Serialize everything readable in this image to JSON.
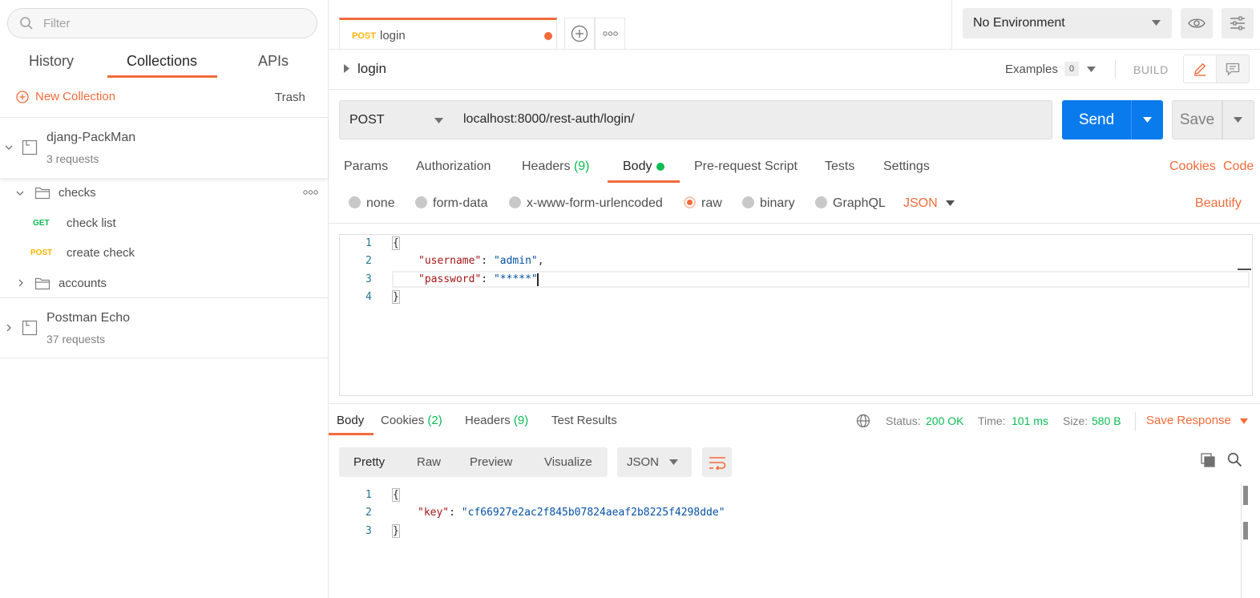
{
  "sidebar": {
    "filter_placeholder": "Filter",
    "tabs": [
      "History",
      "Collections",
      "APIs"
    ],
    "new_collection": "New Collection",
    "trash": "Trash",
    "collections": [
      {
        "name": "djang-PackMan",
        "count": "3 requests",
        "folders": [
          {
            "name": "checks",
            "requests": [
              {
                "method": "GET",
                "name": "check list"
              },
              {
                "method": "POST",
                "name": "create check"
              }
            ]
          },
          {
            "name": "accounts"
          }
        ]
      },
      {
        "name": "Postman Echo",
        "count": "37 requests"
      }
    ]
  },
  "tabbar": {
    "tab_method": "POST",
    "tab_name": "login",
    "environment": "No Environment"
  },
  "request": {
    "name": "login",
    "examples_label": "Examples",
    "examples_count": "0",
    "build_label": "BUILD",
    "method": "POST",
    "url": "localhost:8000/rest-auth/login/",
    "send": "Send",
    "save": "Save",
    "tabs": {
      "params": "Params",
      "authorization": "Authorization",
      "headers": "Headers",
      "headers_count": "(9)",
      "body": "Body",
      "prerequest": "Pre-request Script",
      "tests": "Tests",
      "settings": "Settings"
    },
    "cookies": "Cookies",
    "code": "Code",
    "body_types": [
      "none",
      "form-data",
      "x-www-form-urlencoded",
      "raw",
      "binary",
      "GraphQL"
    ],
    "body_format": "JSON",
    "beautify": "Beautify",
    "body_lines": [
      {
        "n": "1",
        "text": "{"
      },
      {
        "n": "2",
        "key": "\"username\"",
        "value": "\"admin\"",
        "tail": ","
      },
      {
        "n": "3",
        "key": "\"password\"",
        "value": "\"*****\"",
        "tail": ""
      },
      {
        "n": "4",
        "text": "}"
      }
    ]
  },
  "response": {
    "tabs": {
      "body": "Body",
      "cookies": "Cookies",
      "cookies_count": "(2)",
      "headers": "Headers",
      "headers_count": "(9)",
      "test_results": "Test Results"
    },
    "status_label": "Status:",
    "status_value": "200 OK",
    "time_label": "Time:",
    "time_value": "101 ms",
    "size_label": "Size:",
    "size_value": "580 B",
    "save_response": "Save Response",
    "view_modes": [
      "Pretty",
      "Raw",
      "Preview",
      "Visualize"
    ],
    "format": "JSON",
    "body_lines": [
      {
        "n": "1",
        "text": "{"
      },
      {
        "n": "2",
        "key": "\"key\"",
        "value": "\"cf66927e2ac2f845b07824aeaf2b8225f4298dde\""
      },
      {
        "n": "3",
        "text": "}"
      }
    ]
  },
  "colors": {
    "accent": "#f26b3a",
    "primary": "#097bed",
    "success": "#0cbb52",
    "post": "#ffb400"
  }
}
